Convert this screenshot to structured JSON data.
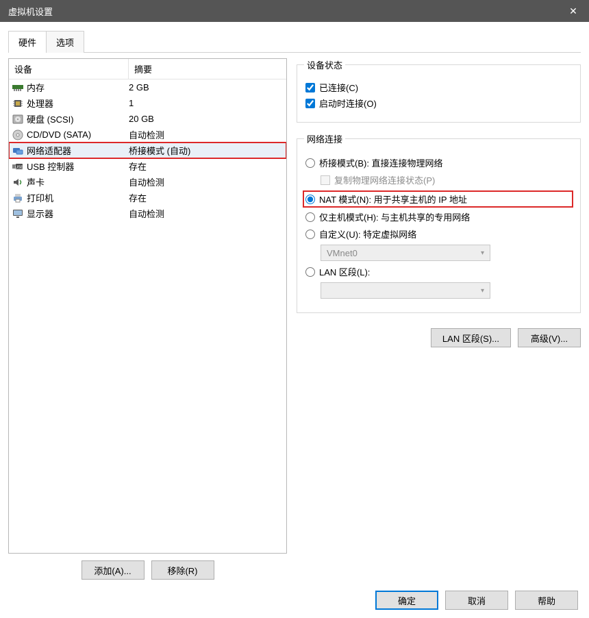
{
  "window": {
    "title": "虚拟机设置"
  },
  "tabs": {
    "hardware": "硬件",
    "options": "选项"
  },
  "table": {
    "headers": {
      "device": "设备",
      "summary": "摘要"
    },
    "rows": [
      {
        "icon": "memory",
        "name": "内存",
        "summary": "2 GB",
        "hl": false
      },
      {
        "icon": "cpu",
        "name": "处理器",
        "summary": "1",
        "hl": false
      },
      {
        "icon": "disk",
        "name": "硬盘 (SCSI)",
        "summary": "20 GB",
        "hl": false
      },
      {
        "icon": "cd",
        "name": "CD/DVD (SATA)",
        "summary": "自动检测",
        "hl": false
      },
      {
        "icon": "net",
        "name": "网络适配器",
        "summary": "桥接模式 (自动)",
        "hl": true
      },
      {
        "icon": "usb",
        "name": "USB 控制器",
        "summary": "存在",
        "hl": false
      },
      {
        "icon": "sound",
        "name": "声卡",
        "summary": "自动检测",
        "hl": false
      },
      {
        "icon": "printer",
        "name": "打印机",
        "summary": "存在",
        "hl": false
      },
      {
        "icon": "display",
        "name": "显示器",
        "summary": "自动检测",
        "hl": false
      }
    ],
    "buttons": {
      "add": "添加(A)...",
      "remove": "移除(R)"
    }
  },
  "status": {
    "legend": "设备状态",
    "connected": "已连接(C)",
    "connectAtPowerOn": "启动时连接(O)"
  },
  "network": {
    "legend": "网络连接",
    "bridged": "桥接模式(B): 直接连接物理网络",
    "replicate": "复制物理网络连接状态(P)",
    "nat": "NAT 模式(N): 用于共享主机的 IP 地址",
    "hostOnly": "仅主机模式(H): 与主机共享的专用网络",
    "custom": "自定义(U): 特定虚拟网络",
    "customNet": "VMnet0",
    "lan": "LAN 区段(L):",
    "lanValue": "",
    "buttons": {
      "lanSegments": "LAN 区段(S)...",
      "advanced": "高级(V)..."
    }
  },
  "dialog": {
    "ok": "确定",
    "cancel": "取消",
    "help": "帮助"
  }
}
